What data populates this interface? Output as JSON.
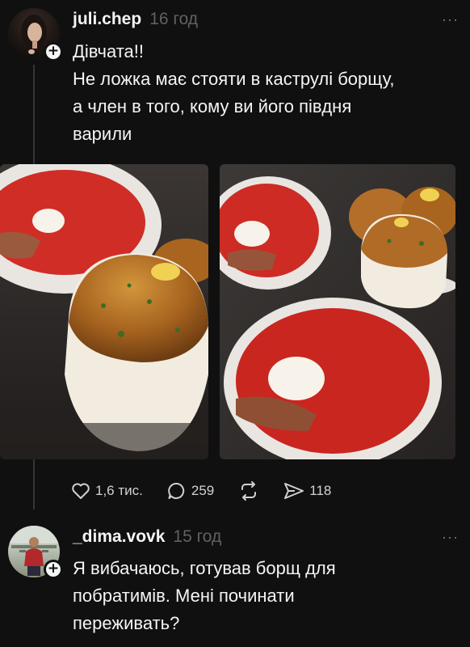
{
  "post": {
    "username": "juli.chep",
    "time": "16 год",
    "more": "···",
    "text": "Дівчата!!\nНе ложка має стояти в каструлі борщу,\nа член в того, кому ви його півдня\nварили",
    "likes": "1,6 тис.",
    "replies": "259",
    "shares": "118",
    "icons": [
      "heart-icon",
      "comment-icon",
      "repost-icon",
      "share-icon",
      "plus-icon",
      "more-icon"
    ]
  },
  "reply": {
    "username": "_dima.vovk",
    "time": "15 год",
    "more": "···",
    "text": "Я вибачаюсь, готував борщ для\nпобратимів. Мені починати\nпереживать?"
  }
}
